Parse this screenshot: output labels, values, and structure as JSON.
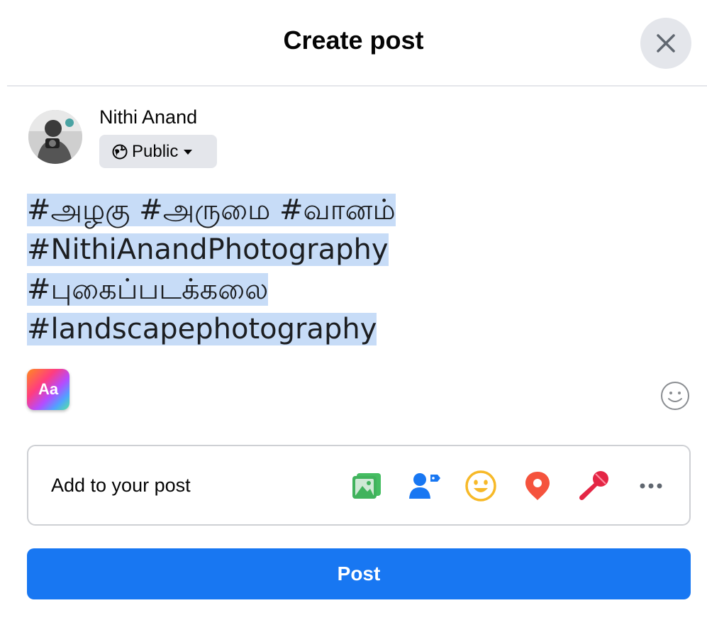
{
  "dialog": {
    "title": "Create post",
    "close_icon": "close-icon"
  },
  "user": {
    "name": "Nithi Anand",
    "privacy_label": "Public",
    "privacy_icon": "globe-icon"
  },
  "composer": {
    "lines": [
      "#அழகு #அருமை #வானம்",
      "#NithiAnandPhotography",
      "#புகைப்படக்கலை",
      "#landscapephotography"
    ],
    "background_button_label": "Aa"
  },
  "add_to_post": {
    "label": "Add to your post",
    "tools": [
      "photo-video-icon",
      "tag-people-icon",
      "feeling-activity-icon",
      "check-in-icon",
      "live-mic-icon",
      "more-icon"
    ]
  },
  "post_button": {
    "label": "Post"
  },
  "colors": {
    "accent": "#1877f2",
    "selection": "#c7dcf7"
  }
}
